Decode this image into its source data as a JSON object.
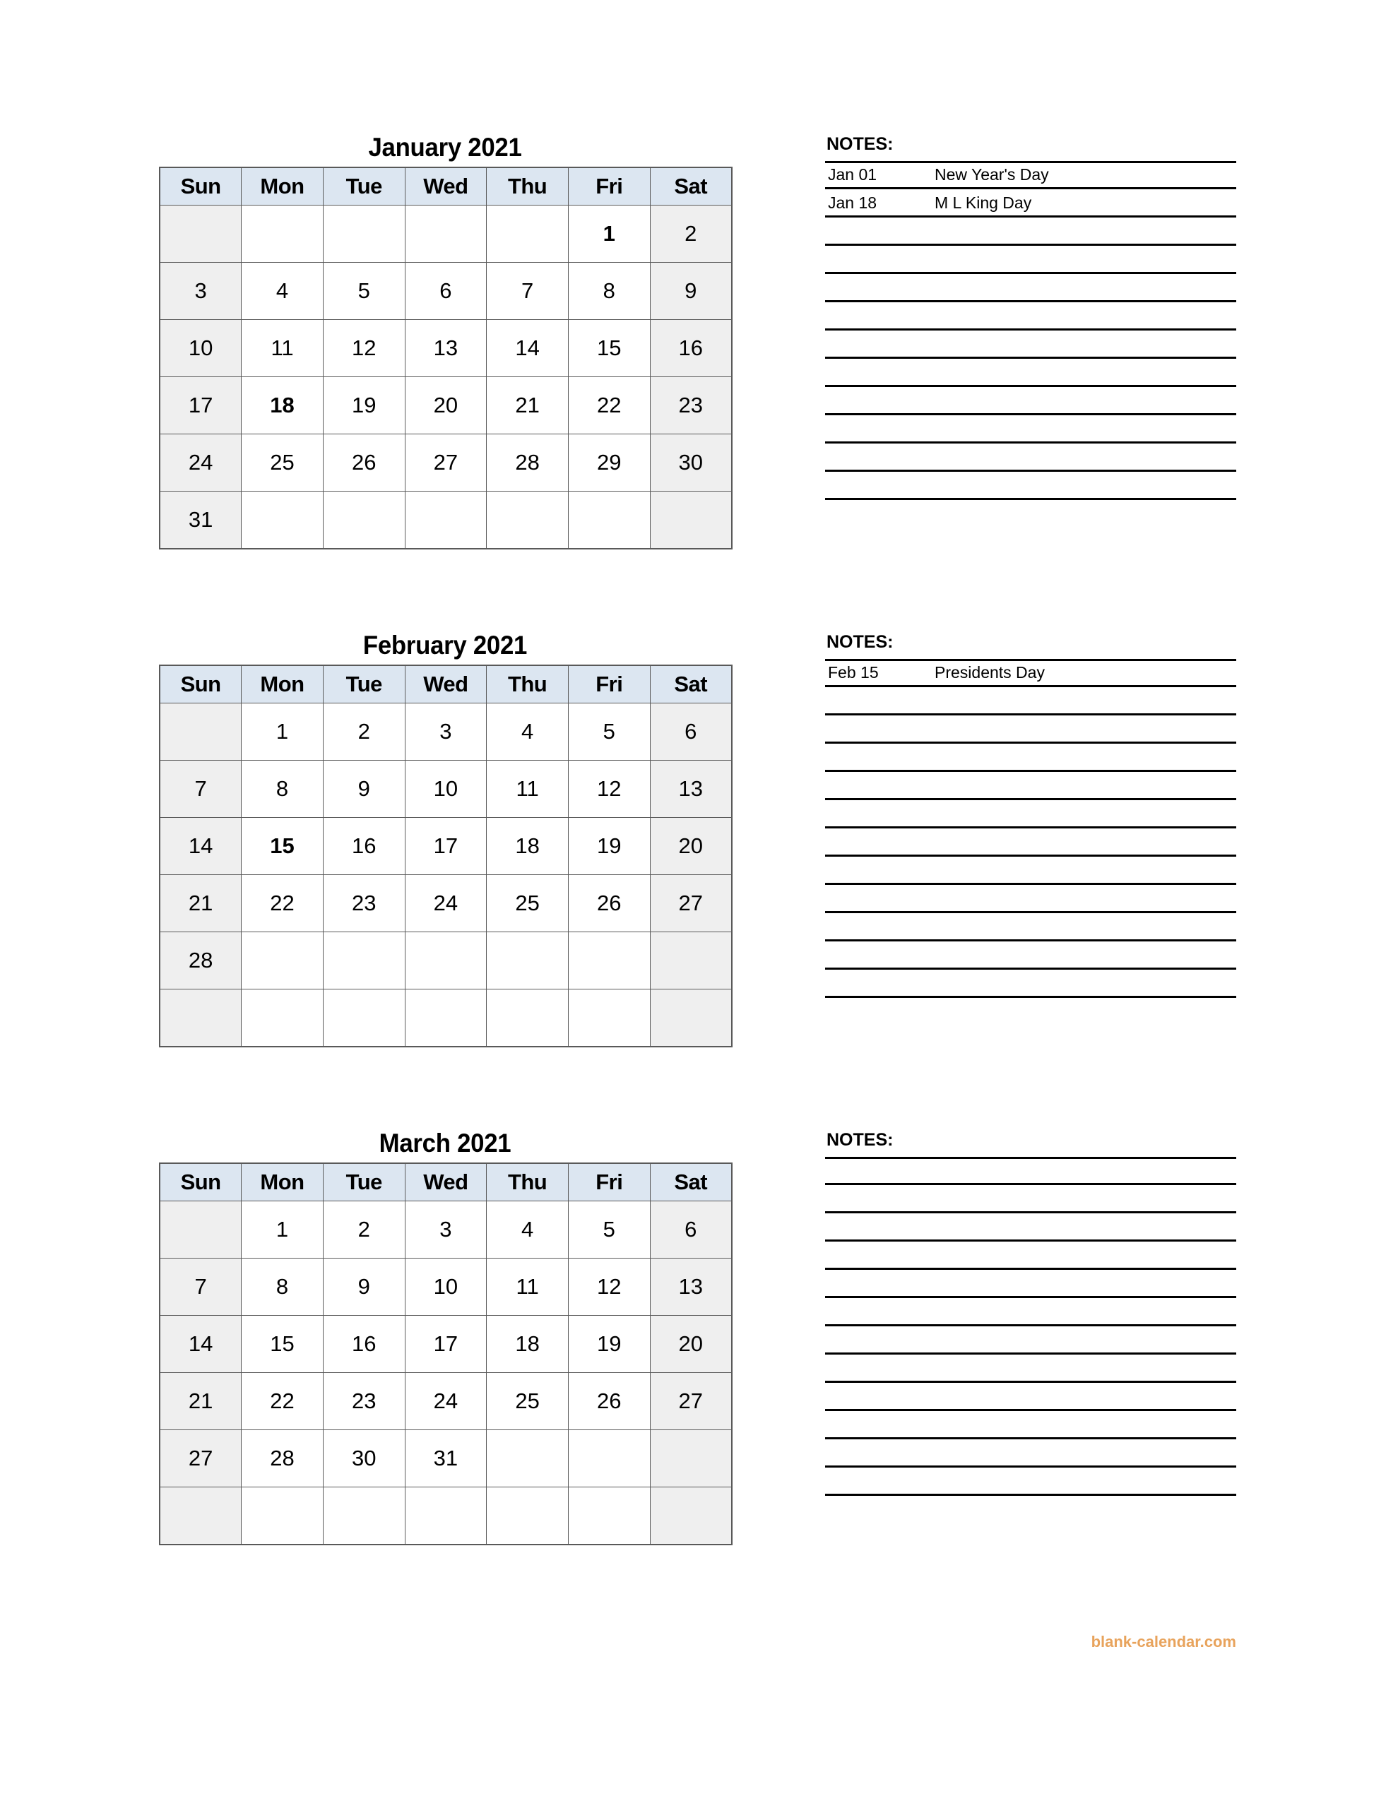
{
  "footer": {
    "credit": "blank-calendar.com"
  },
  "notes_label": "NOTES:",
  "weekday_headers": [
    "Sun",
    "Mon",
    "Tue",
    "Wed",
    "Thu",
    "Fri",
    "Sat"
  ],
  "colors": {
    "header_fill": "#dce6f1",
    "weekend_fill": "#efefef",
    "grid_line": "#595959",
    "rule_line": "#000000",
    "credit": "#e8a35c",
    "text": "#000000"
  },
  "months": [
    {
      "title": "January 2021",
      "weeks": [
        [
          "",
          "",
          "",
          "",
          "",
          "1",
          "2"
        ],
        [
          "3",
          "4",
          "5",
          "6",
          "7",
          "8",
          "9"
        ],
        [
          "10",
          "11",
          "12",
          "13",
          "14",
          "15",
          "16"
        ],
        [
          "17",
          "18",
          "19",
          "20",
          "21",
          "22",
          "23"
        ],
        [
          "24",
          "25",
          "26",
          "27",
          "28",
          "29",
          "30"
        ],
        [
          "31",
          "",
          "",
          "",
          "",
          "",
          ""
        ]
      ],
      "holidays": [
        "1",
        "18"
      ],
      "notes": [
        {
          "date": "Jan 01",
          "text": "New Year's Day"
        },
        {
          "date": "Jan 18",
          "text": "M L King Day"
        },
        {
          "date": "",
          "text": ""
        },
        {
          "date": "",
          "text": ""
        },
        {
          "date": "",
          "text": ""
        },
        {
          "date": "",
          "text": ""
        },
        {
          "date": "",
          "text": ""
        },
        {
          "date": "",
          "text": ""
        },
        {
          "date": "",
          "text": ""
        },
        {
          "date": "",
          "text": ""
        },
        {
          "date": "",
          "text": ""
        },
        {
          "date": "",
          "text": ""
        }
      ]
    },
    {
      "title": "February 2021",
      "weeks": [
        [
          "",
          "1",
          "2",
          "3",
          "4",
          "5",
          "6"
        ],
        [
          "7",
          "8",
          "9",
          "10",
          "11",
          "12",
          "13"
        ],
        [
          "14",
          "15",
          "16",
          "17",
          "18",
          "19",
          "20"
        ],
        [
          "21",
          "22",
          "23",
          "24",
          "25",
          "26",
          "27"
        ],
        [
          "28",
          "",
          "",
          "",
          "",
          "",
          ""
        ],
        [
          "",
          "",
          "",
          "",
          "",
          "",
          ""
        ]
      ],
      "holidays": [
        "15"
      ],
      "notes": [
        {
          "date": "Feb 15",
          "text": "Presidents Day"
        },
        {
          "date": "",
          "text": ""
        },
        {
          "date": "",
          "text": ""
        },
        {
          "date": "",
          "text": ""
        },
        {
          "date": "",
          "text": ""
        },
        {
          "date": "",
          "text": ""
        },
        {
          "date": "",
          "text": ""
        },
        {
          "date": "",
          "text": ""
        },
        {
          "date": "",
          "text": ""
        },
        {
          "date": "",
          "text": ""
        },
        {
          "date": "",
          "text": ""
        },
        {
          "date": "",
          "text": ""
        }
      ]
    },
    {
      "title": "March 2021",
      "weeks": [
        [
          "",
          "1",
          "2",
          "3",
          "4",
          "5",
          "6"
        ],
        [
          "7",
          "8",
          "9",
          "10",
          "11",
          "12",
          "13"
        ],
        [
          "14",
          "15",
          "16",
          "17",
          "18",
          "19",
          "20"
        ],
        [
          "21",
          "22",
          "23",
          "24",
          "25",
          "26",
          "27"
        ],
        [
          "27",
          "28",
          "30",
          "31",
          "",
          "",
          ""
        ],
        [
          "",
          "",
          "",
          "",
          "",
          "",
          ""
        ]
      ],
      "holidays": [],
      "notes": [
        {
          "date": "",
          "text": ""
        },
        {
          "date": "",
          "text": ""
        },
        {
          "date": "",
          "text": ""
        },
        {
          "date": "",
          "text": ""
        },
        {
          "date": "",
          "text": ""
        },
        {
          "date": "",
          "text": ""
        },
        {
          "date": "",
          "text": ""
        },
        {
          "date": "",
          "text": ""
        },
        {
          "date": "",
          "text": ""
        },
        {
          "date": "",
          "text": ""
        },
        {
          "date": "",
          "text": ""
        },
        {
          "date": "",
          "text": ""
        }
      ]
    }
  ]
}
